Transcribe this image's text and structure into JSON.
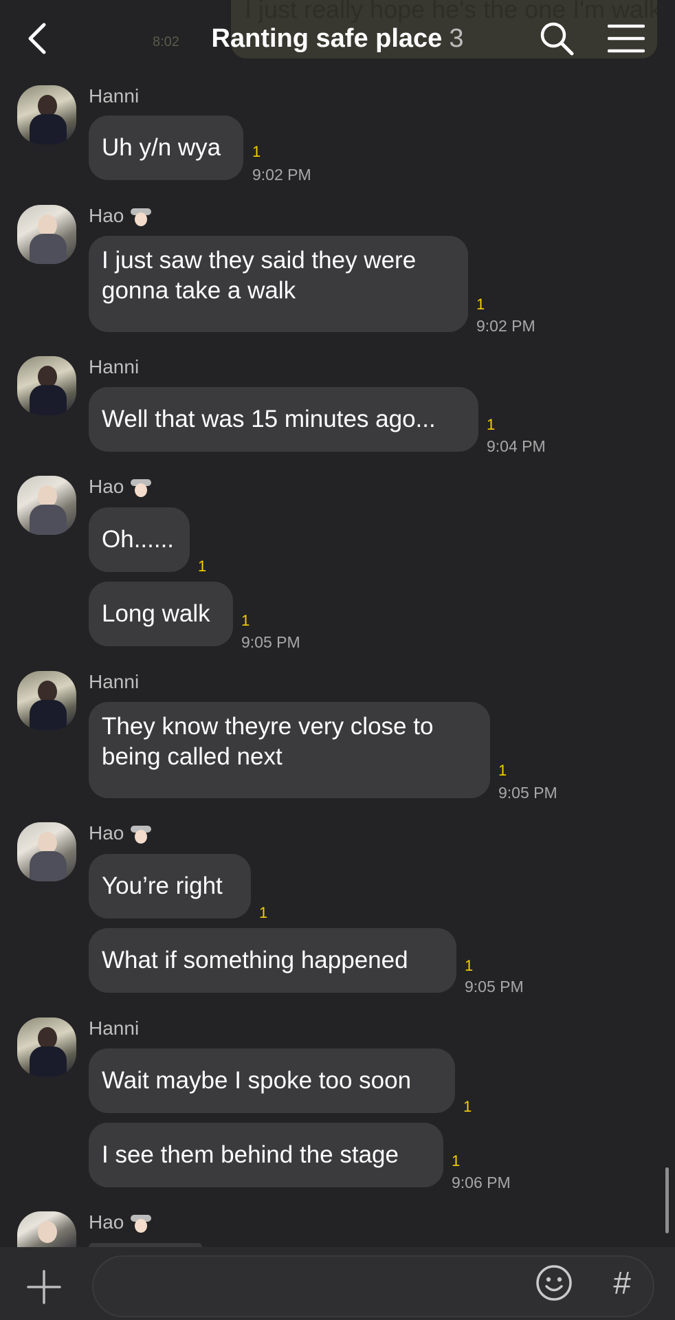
{
  "background_ghost": {
    "text": "I just really hope he's the one I'm walking down there with",
    "time": "8:02"
  },
  "header": {
    "title": "Ranting safe place",
    "member_count": "3",
    "icons": [
      "back-chevron-icon",
      "search-icon",
      "menu-icon"
    ]
  },
  "messages": [
    {
      "sender": "Hanni",
      "text": "Uh y/n wya",
      "unread": "1",
      "time": "9:02 PM"
    },
    {
      "sender": "Hao",
      "text": "I just saw they said they were gonna take a walk",
      "unread": "1",
      "time": "9:02 PM"
    },
    {
      "sender": "Hanni",
      "text": "Well that was 15 minutes ago...",
      "unread": "1",
      "time": "9:04 PM"
    },
    {
      "sender": "Hao",
      "text": "Oh......",
      "unread": "1",
      "time": ""
    },
    {
      "sender": "Hao",
      "text": "Long walk",
      "unread": "1",
      "time": "9:05 PM"
    },
    {
      "sender": "Hanni",
      "text": "They know theyre very close to being called next",
      "unread": "1",
      "time": "9:05 PM"
    },
    {
      "sender": "Hao",
      "text": "You’re right",
      "unread": "1",
      "time": ""
    },
    {
      "sender": "Hao",
      "text": "What if something happened",
      "unread": "1",
      "time": "9:05 PM"
    },
    {
      "sender": "Hanni",
      "text": "Wait maybe I spoke too soon",
      "unread": "1",
      "time": ""
    },
    {
      "sender": "Hanni",
      "text": "I see them behind the stage",
      "unread": "1",
      "time": "9:06 PM"
    },
    {
      "sender": "Hao",
      "text": "",
      "unread": "",
      "time": ""
    }
  ],
  "composer": {
    "placeholder": "",
    "hash_label": "#",
    "icons": [
      "plus-icon",
      "emoji-icon",
      "hashtag-icon"
    ]
  },
  "colors": {
    "background": "#232325",
    "bubble": "#3b3b3e",
    "unread": "#f5d000",
    "timestamp": "#a8a8a8"
  }
}
